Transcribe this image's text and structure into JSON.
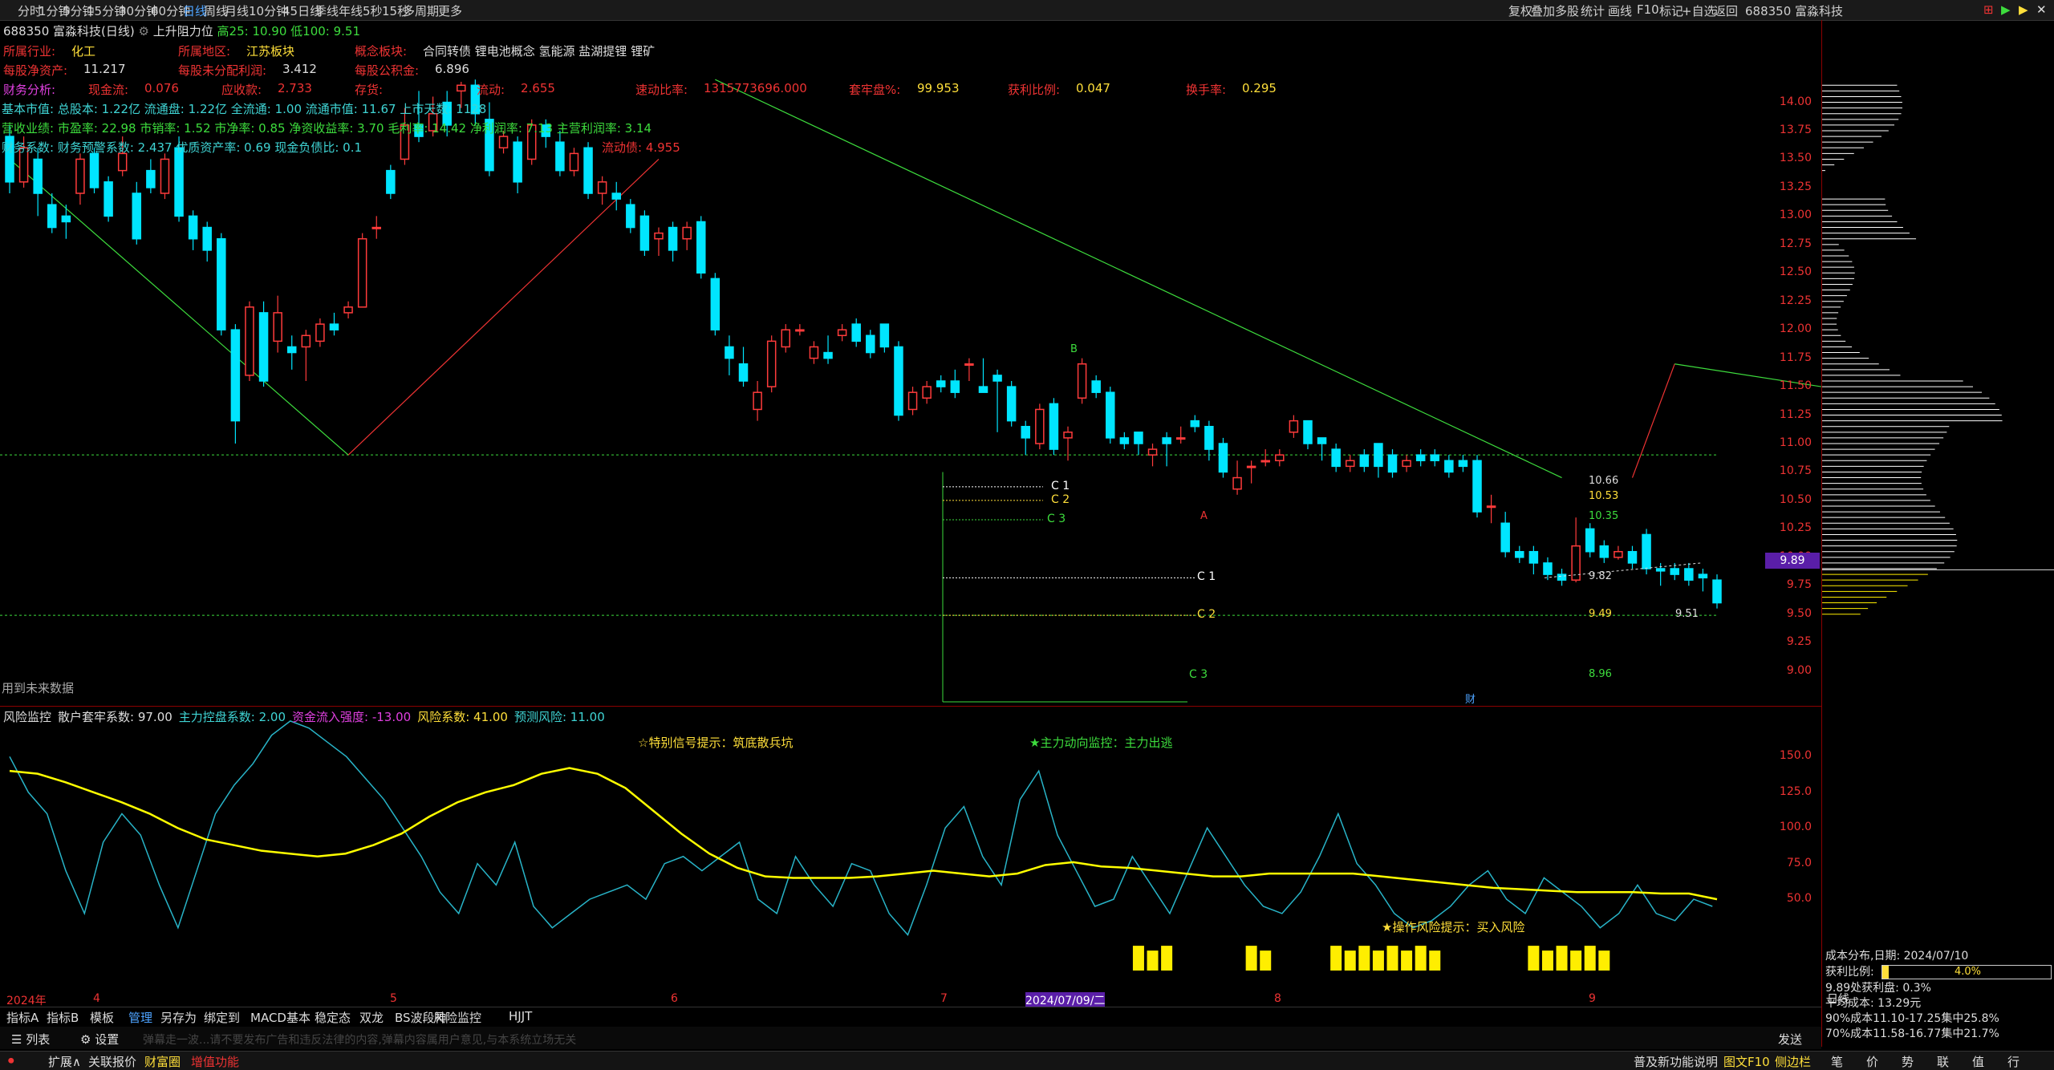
{
  "toolbar": {
    "periods": [
      "分时",
      "1分钟",
      "5分钟",
      "15分钟",
      "30分钟",
      "60分钟",
      "日线",
      "周线",
      "月线",
      "10分钟",
      "45日线",
      "季线",
      "年线",
      "5秒",
      "15秒",
      "多周期",
      "更多"
    ],
    "active": "日线",
    "right_items": [
      "复权",
      "叠加",
      "多股",
      "统计",
      "画线",
      "F10",
      "标记",
      "+自选",
      "返回"
    ],
    "right_stock": "688350 富淼科技"
  },
  "chart_title": {
    "code_name": "688350 富淼科技(日线)",
    "indicator": "上升阻力位",
    "high": "高25: 10.90",
    "low": "低100: 9.51"
  },
  "fundamentals": {
    "row1": [
      {
        "label": "所属行业:",
        "value": "化工"
      },
      {
        "label": "所属地区:",
        "value": "江苏板块"
      },
      {
        "label": "概念板块:",
        "value": "合同转债 锂电池概念 氢能源 盐湖提锂 锂矿"
      }
    ],
    "row2": [
      {
        "label": "每股净资产:",
        "value": "11.217"
      },
      {
        "label": "每股未分配利润:",
        "value": "3.412"
      },
      {
        "label": "每股公积金:",
        "value": "6.896"
      }
    ],
    "row3": [
      {
        "label": "财务分析:",
        "value": ""
      },
      {
        "label": "现金流:",
        "value": "0.076"
      },
      {
        "label": "应收款:",
        "value": "2.733"
      },
      {
        "label": "存货:",
        "value": ""
      },
      {
        "label": "流动:",
        "value": "2.655"
      },
      {
        "label": "速动比率:",
        "value": "1315773696.000"
      },
      {
        "label": "套牢盘%:",
        "value": "99.953"
      },
      {
        "label": "获利比例:",
        "value": "0.047"
      },
      {
        "label": "换手率:",
        "value": "0.295"
      }
    ],
    "row4": "基本市值: 总股本: 1.22亿 流通盘: 1.22亿 全流通: 1.00 流通市值: 11.67 上市天数: 1128",
    "row5": "营收业绩: 市盈率: 22.98 市销率: 1.52 市净率: 0.85 净资收益率: 3.70 毛利率: 14.42 净利润率: 7.13 主营利润率: 3.14",
    "row6": "财务系数: 财务预警系数: 2.437 优质资产率: 0.69 现金负债比: 0.1",
    "row6b": "流动债: 4.955",
    "future_note": "用到未来数据"
  },
  "annotations": {
    "c_labels": [
      "C 1",
      "C 2",
      "C 3",
      "C 1",
      "C 2",
      "C 3"
    ],
    "ab_labels": [
      "B",
      "A"
    ],
    "price_tags": [
      "10.66",
      "10.53",
      "10.35",
      "9.82",
      "9.49",
      "9.51",
      "8.96"
    ],
    "marker_cai": "财"
  },
  "price_axis": {
    "ticks": [
      "14.00",
      "13.75",
      "13.50",
      "13.25",
      "13.00",
      "12.75",
      "12.50",
      "12.25",
      "12.00",
      "11.75",
      "11.50",
      "11.25",
      "11.00",
      "10.75",
      "10.50",
      "10.25",
      "10.00",
      "9.75",
      "9.50",
      "9.25",
      "9.00"
    ],
    "current_price": "9.89"
  },
  "sub_chart": {
    "header": [
      {
        "text": "风险监控",
        "cls": "lbl-white"
      },
      {
        "text": "散户套牢系数: 97.00",
        "cls": "lbl-white"
      },
      {
        "text": "主力控盘系数: 2.00",
        "cls": "lbl-cyan"
      },
      {
        "text": "资金流入强度: -13.00",
        "cls": "lbl-mag"
      },
      {
        "text": "风险系数: 41.00",
        "cls": "lbl-yel"
      },
      {
        "text": "预测风险: 11.00",
        "cls": "lbl-cyan"
      }
    ],
    "signal1": "☆特别信号提示：筑底散兵坑",
    "signal2": "★主力动向监控：主力出逃",
    "signal3": "★操作风险提示：买入风险",
    "axis_ticks": [
      "150.0",
      "125.0",
      "100.0",
      "75.0",
      "50.0"
    ]
  },
  "date_axis": {
    "labels": [
      "2024年",
      "4",
      "5",
      "6",
      "7",
      "2024/07/09/二",
      "8",
      "9"
    ],
    "right": "日线"
  },
  "indicator_tabs": [
    "指标A",
    "指标B",
    "模板",
    "管理",
    "另存为",
    "绑定到",
    "MACD基本",
    "稳定态",
    "双龙",
    "BS波段神",
    "风险监控",
    "HJJT"
  ],
  "bottom2": {
    "list": "列表",
    "settings": "设置",
    "placeholder": "弹幕走一波...请不要发布广告和违反法律的内容,弹幕内容属用户意见,与本系统立场无关",
    "send": "发送"
  },
  "bottom3": {
    "left": [
      "扩展∧",
      "关联报价",
      "财富圈",
      "增值功能"
    ],
    "right_info": "普及新功能说明",
    "right_links": [
      "图文F10",
      "侧边栏"
    ],
    "right_icons": [
      "笔",
      "价",
      "势",
      "联",
      "值",
      "行"
    ]
  },
  "right_panel": {
    "title": "688350 富淼科技",
    "dist_title": "成本分布,日期: 2024/07/10",
    "profit_ratio_label": "获利比例:",
    "profit_ratio_value": "4.0%",
    "profit_ratio_fraction": 0.04,
    "lines": [
      "9.89处获利盘: 0.3%",
      "平均成本: 13.29元",
      "90%成本11.10-17.25集中25.8%",
      "70%成本11.58-16.77集中21.7%"
    ]
  },
  "chart_data": {
    "type": "candlestick",
    "price_range": [
      8.8,
      14.3
    ],
    "candles": [
      [
        13.7,
        13.3,
        13.8,
        13.2
      ],
      [
        13.3,
        13.6,
        13.7,
        13.25
      ],
      [
        13.5,
        13.2,
        13.6,
        13.0
      ],
      [
        13.1,
        12.9,
        13.2,
        12.85
      ],
      [
        13.0,
        12.95,
        13.1,
        12.8
      ],
      [
        13.2,
        13.5,
        13.55,
        13.1
      ],
      [
        13.55,
        13.25,
        13.6,
        13.2
      ],
      [
        13.3,
        13.0,
        13.35,
        12.95
      ],
      [
        13.4,
        13.55,
        13.7,
        13.35
      ],
      [
        13.2,
        12.8,
        13.3,
        12.75
      ],
      [
        13.4,
        13.25,
        13.5,
        13.2
      ],
      [
        13.2,
        13.5,
        13.55,
        13.15
      ],
      [
        13.6,
        13.0,
        13.7,
        12.95
      ],
      [
        13.0,
        12.8,
        13.05,
        12.7
      ],
      [
        12.9,
        12.7,
        12.95,
        12.6
      ],
      [
        12.8,
        12.0,
        12.85,
        11.95
      ],
      [
        12.0,
        11.2,
        12.05,
        11.0
      ],
      [
        11.6,
        12.2,
        12.25,
        11.55
      ],
      [
        12.15,
        11.55,
        12.25,
        11.5
      ],
      [
        11.9,
        12.15,
        12.3,
        11.8
      ],
      [
        11.85,
        11.8,
        11.95,
        11.65
      ],
      [
        11.85,
        11.95,
        12.0,
        11.55
      ],
      [
        11.9,
        12.05,
        12.1,
        11.85
      ],
      [
        12.05,
        12.0,
        12.15,
        11.95
      ],
      [
        12.15,
        12.2,
        12.25,
        12.1
      ],
      [
        12.2,
        12.8,
        12.85,
        12.2
      ],
      [
        12.9,
        12.9,
        13.0,
        12.8
      ],
      [
        13.4,
        13.2,
        13.45,
        13.15
      ],
      [
        13.5,
        13.8,
        13.95,
        13.45
      ],
      [
        13.8,
        13.7,
        14.1,
        13.65
      ],
      [
        13.75,
        13.9,
        14.05,
        13.7
      ],
      [
        14.0,
        13.8,
        14.1,
        13.7
      ],
      [
        14.1,
        14.15,
        14.18,
        13.95
      ],
      [
        14.15,
        13.9,
        14.2,
        13.8
      ],
      [
        13.85,
        13.4,
        14.0,
        13.35
      ],
      [
        13.6,
        13.7,
        13.75,
        13.55
      ],
      [
        13.65,
        13.3,
        13.7,
        13.2
      ],
      [
        13.5,
        13.8,
        13.85,
        13.45
      ],
      [
        13.8,
        13.7,
        13.85,
        13.6
      ],
      [
        13.65,
        13.4,
        13.75,
        13.35
      ],
      [
        13.4,
        13.55,
        13.6,
        13.35
      ],
      [
        13.6,
        13.2,
        13.65,
        13.15
      ],
      [
        13.2,
        13.3,
        13.35,
        13.1
      ],
      [
        13.2,
        13.15,
        13.3,
        13.05
      ],
      [
        13.1,
        12.9,
        13.15,
        12.85
      ],
      [
        13.0,
        12.7,
        13.05,
        12.65
      ],
      [
        12.8,
        12.85,
        12.9,
        12.65
      ],
      [
        12.9,
        12.7,
        12.95,
        12.6
      ],
      [
        12.8,
        12.9,
        12.95,
        12.7
      ],
      [
        12.95,
        12.5,
        13.0,
        12.45
      ],
      [
        12.45,
        12.0,
        12.5,
        11.95
      ],
      [
        11.85,
        11.75,
        11.95,
        11.6
      ],
      [
        11.7,
        11.55,
        11.85,
        11.5
      ],
      [
        11.3,
        11.45,
        11.55,
        11.2
      ],
      [
        11.5,
        11.9,
        11.95,
        11.45
      ],
      [
        11.85,
        12.0,
        12.05,
        11.8
      ],
      [
        12.0,
        12.0,
        12.05,
        11.95
      ],
      [
        11.75,
        11.85,
        11.9,
        11.7
      ],
      [
        11.8,
        11.75,
        11.95,
        11.7
      ],
      [
        11.95,
        12.0,
        12.05,
        11.9
      ],
      [
        12.05,
        11.9,
        12.1,
        11.85
      ],
      [
        11.95,
        11.8,
        12.0,
        11.75
      ],
      [
        12.05,
        11.85,
        12.05,
        11.8
      ],
      [
        11.85,
        11.25,
        11.9,
        11.2
      ],
      [
        11.3,
        11.45,
        11.5,
        11.25
      ],
      [
        11.4,
        11.5,
        11.55,
        11.35
      ],
      [
        11.55,
        11.5,
        11.6,
        11.45
      ],
      [
        11.55,
        11.45,
        11.65,
        11.4
      ],
      [
        11.7,
        11.7,
        11.75,
        11.55
      ],
      [
        11.5,
        11.45,
        11.75,
        11.45
      ],
      [
        11.6,
        11.55,
        11.65,
        11.1
      ],
      [
        11.5,
        11.2,
        11.55,
        11.15
      ],
      [
        11.15,
        11.05,
        11.2,
        10.9
      ],
      [
        11.0,
        11.3,
        11.35,
        10.95
      ],
      [
        11.35,
        10.95,
        11.4,
        10.9
      ],
      [
        11.05,
        11.1,
        11.15,
        10.85
      ],
      [
        11.4,
        11.7,
        11.75,
        11.35
      ],
      [
        11.55,
        11.45,
        11.6,
        11.4
      ],
      [
        11.45,
        11.05,
        11.5,
        11.0
      ],
      [
        11.05,
        11.0,
        11.1,
        10.95
      ],
      [
        11.1,
        11.0,
        11.1,
        10.9
      ],
      [
        10.9,
        10.95,
        11.0,
        10.8
      ],
      [
        11.05,
        11.0,
        11.1,
        10.8
      ],
      [
        11.05,
        11.05,
        11.15,
        11.0
      ],
      [
        11.2,
        11.15,
        11.25,
        11.1
      ],
      [
        11.15,
        10.95,
        11.2,
        10.85
      ],
      [
        11.0,
        10.75,
        11.05,
        10.7
      ],
      [
        10.6,
        10.7,
        10.85,
        10.55
      ],
      [
        10.8,
        10.8,
        10.85,
        10.65
      ],
      [
        10.85,
        10.85,
        10.95,
        10.8
      ],
      [
        10.85,
        10.9,
        10.95,
        10.8
      ],
      [
        11.1,
        11.2,
        11.25,
        11.05
      ],
      [
        11.2,
        11.0,
        11.2,
        10.95
      ],
      [
        11.05,
        11.0,
        11.05,
        10.85
      ],
      [
        10.95,
        10.8,
        11.0,
        10.75
      ],
      [
        10.8,
        10.85,
        10.9,
        10.75
      ],
      [
        10.9,
        10.8,
        10.95,
        10.75
      ],
      [
        11.0,
        10.8,
        11.0,
        10.7
      ],
      [
        10.9,
        10.75,
        10.95,
        10.7
      ],
      [
        10.8,
        10.85,
        10.9,
        10.75
      ],
      [
        10.9,
        10.85,
        10.95,
        10.8
      ],
      [
        10.9,
        10.85,
        10.95,
        10.8
      ],
      [
        10.85,
        10.75,
        10.9,
        10.7
      ],
      [
        10.85,
        10.8,
        10.9,
        10.75
      ],
      [
        10.85,
        10.4,
        10.9,
        10.35
      ],
      [
        10.45,
        10.45,
        10.55,
        10.3
      ],
      [
        10.3,
        10.05,
        10.4,
        10.0
      ],
      [
        10.05,
        10.0,
        10.1,
        9.95
      ],
      [
        10.05,
        9.95,
        10.1,
        9.85
      ],
      [
        9.95,
        9.85,
        10.0,
        9.8
      ],
      [
        9.85,
        9.8,
        9.9,
        9.75
      ],
      [
        9.8,
        10.1,
        10.35,
        9.78
      ],
      [
        10.25,
        10.05,
        10.3,
        10.0
      ],
      [
        10.1,
        10.0,
        10.15,
        9.95
      ],
      [
        10.0,
        10.05,
        10.1,
        9.98
      ],
      [
        10.05,
        9.95,
        10.1,
        9.9
      ],
      [
        10.2,
        9.9,
        10.25,
        9.85
      ],
      [
        9.9,
        9.88,
        9.95,
        9.75
      ],
      [
        9.9,
        9.85,
        9.95,
        9.8
      ],
      [
        9.9,
        9.8,
        9.95,
        9.75
      ],
      [
        9.85,
        9.82,
        9.9,
        9.7
      ],
      [
        9.8,
        9.6,
        9.85,
        9.55
      ]
    ]
  }
}
